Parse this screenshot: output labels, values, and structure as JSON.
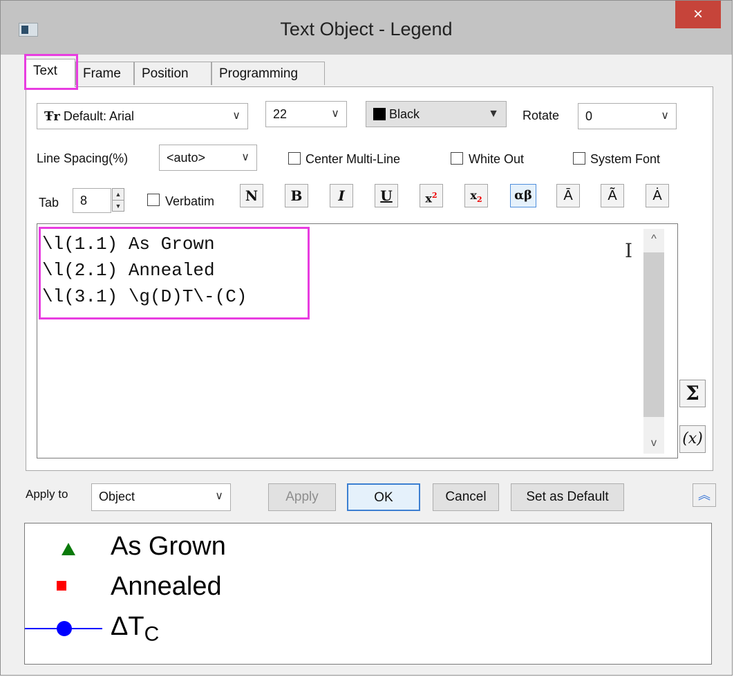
{
  "window": {
    "title": "Text Object - Legend",
    "close_glyph": "×"
  },
  "tabs": [
    {
      "label": "Text",
      "active": true
    },
    {
      "label": "Frame"
    },
    {
      "label": "Position"
    },
    {
      "label": "Programming"
    }
  ],
  "font": {
    "icon": "font-type-icon",
    "value": "Default: Arial"
  },
  "size": {
    "value": "22"
  },
  "color": {
    "value": "Black",
    "swatch": "#000000"
  },
  "rotate": {
    "label": "Rotate",
    "value": "0"
  },
  "line_spacing": {
    "label": "Line Spacing(%)",
    "value": "<auto>"
  },
  "checks": {
    "center_multiline": "Center Multi-Line",
    "white_out": "White Out",
    "system_font": "System Font",
    "verbatim": "Verbatim"
  },
  "tab": {
    "label": "Tab",
    "value": "8"
  },
  "format_buttons": {
    "normal": "N",
    "bold": "B",
    "italic": "I",
    "underline": "U",
    "superscript": "x",
    "superscript_mark": "2",
    "subscript": "x",
    "subscript_mark": "2",
    "greek": "αβ",
    "overbar": "Ā",
    "tilde": "Ã",
    "dot": "Ȧ"
  },
  "editor": {
    "lines": [
      "\\l(1.1) As Grown",
      "\\l(2.1) Annealed",
      "\\l(3.1) \\g(D)T\\-(C)"
    ]
  },
  "side_buttons": {
    "sigma": "Σ",
    "variable": "(x)"
  },
  "footer": {
    "apply_to_label": "Apply to",
    "apply_to_value": "Object",
    "apply": "Apply",
    "ok": "OK",
    "cancel": "Cancel",
    "set_default": "Set as Default",
    "collapse_glyph": "︽"
  },
  "preview": {
    "items": [
      {
        "symbol": "triangle",
        "color": "#0a7a0a",
        "text": "As Grown"
      },
      {
        "symbol": "square",
        "color": "#ff0000",
        "text": "Annealed"
      },
      {
        "symbol": "line-circle",
        "color": "#0000ff",
        "text": "ΔT",
        "subscript": "C"
      }
    ]
  }
}
